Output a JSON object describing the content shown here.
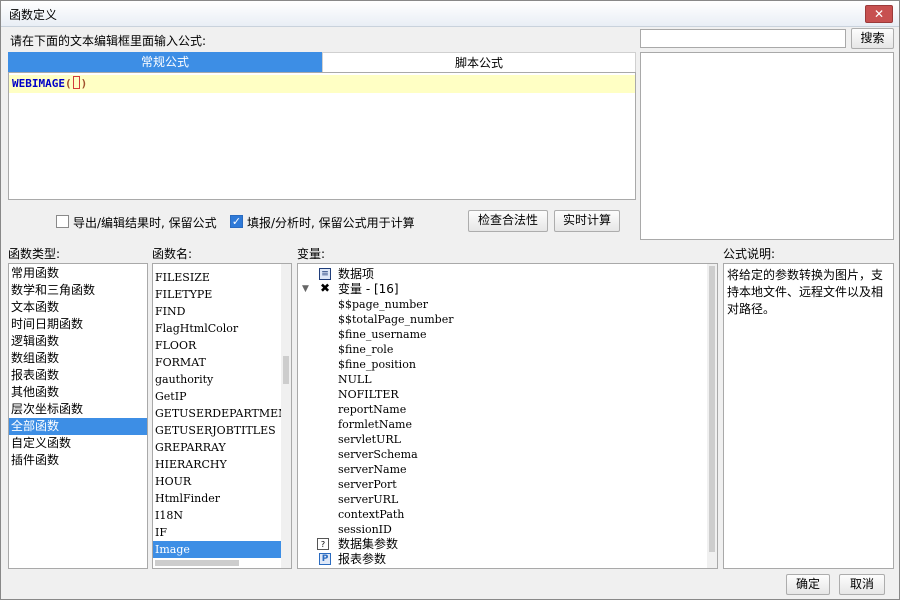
{
  "window": {
    "title": "函数定义",
    "close_label": "✕"
  },
  "prompt_label": "请在下面的文本编辑框里面输入公式:",
  "search": {
    "value": "",
    "button_label": "搜索"
  },
  "tabs": [
    {
      "label": "常规公式",
      "active": true
    },
    {
      "label": "脚本公式",
      "active": false
    }
  ],
  "editor": {
    "func": "WEBIMAGE",
    "open": "(",
    "close": ")"
  },
  "options": {
    "keep_on_export": {
      "label": "导出/编辑结果时, 保留公式",
      "checked": false
    },
    "keep_on_fill": {
      "label": "填报/分析时, 保留公式用于计算",
      "checked": true
    }
  },
  "buttons": {
    "check": "检查合法性",
    "realtime": "实时计算",
    "ok": "确定",
    "cancel": "取消"
  },
  "sections": {
    "func_type": "函数类型:",
    "func_name": "函数名:",
    "variables": "变量:",
    "description": "公式说明:"
  },
  "func_types": [
    "常用函数",
    "数学和三角函数",
    "文本函数",
    "时间日期函数",
    "逻辑函数",
    "数组函数",
    "报表函数",
    "其他函数",
    "层次坐标函数",
    "全部函数",
    "自定义函数",
    "插件函数"
  ],
  "func_type_selected": 9,
  "func_names": [
    "FILESIZE",
    "FILETYPE",
    "FIND",
    "FlagHtmlColor",
    "FLOOR",
    "FORMAT",
    "gauthority",
    "GetIP",
    "GETUSERDEPARTMENTS",
    "GETUSERJOBTITLES",
    "GREPARRAY",
    "HIERARCHY",
    "HOUR",
    "HtmlFinder",
    "I18N",
    "IF",
    "Image"
  ],
  "func_name_selected": 16,
  "tree": {
    "data_items": "数据项",
    "variables_group": "变量 - [16]",
    "variables": [
      "$$page_number",
      "$$totalPage_number",
      "$fine_username",
      "$fine_role",
      "$fine_position",
      "NULL",
      "NOFILTER",
      "reportName",
      "formletName",
      "servletURL",
      "serverSchema",
      "serverName",
      "serverPort",
      "serverURL",
      "contextPath",
      "sessionID"
    ],
    "dataset_params": "数据集参数",
    "report_params": "报表参数"
  },
  "description_text": "将给定的参数转换为图片，支持本地文件、远程文件以及相对路径。"
}
